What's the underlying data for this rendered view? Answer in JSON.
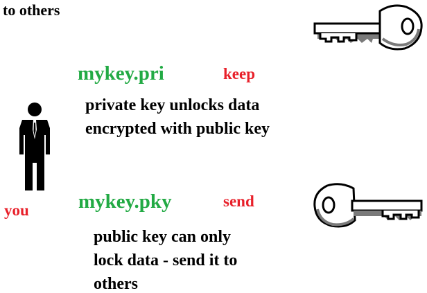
{
  "intro": {
    "text": "to others"
  },
  "private_key": {
    "filename": "mykey.pri",
    "action": "keep",
    "description_lines": [
      "private key unlocks data",
      "encrypted with public key"
    ]
  },
  "public_key": {
    "filename": "mykey.pky",
    "action": "send",
    "description_lines": [
      "public key can only",
      "lock data - send it to",
      "others"
    ]
  },
  "person": {
    "label": "you",
    "icon": "person-icon"
  },
  "icons": {
    "top_key": "key-icon",
    "bottom_key": "key-icon"
  },
  "colors": {
    "filename": "#22aa44",
    "action": "#e8202a",
    "text": "#000000",
    "key_fill": "#ffffff",
    "key_outline": "#000000",
    "key_shadow": "#7a7a7a"
  }
}
